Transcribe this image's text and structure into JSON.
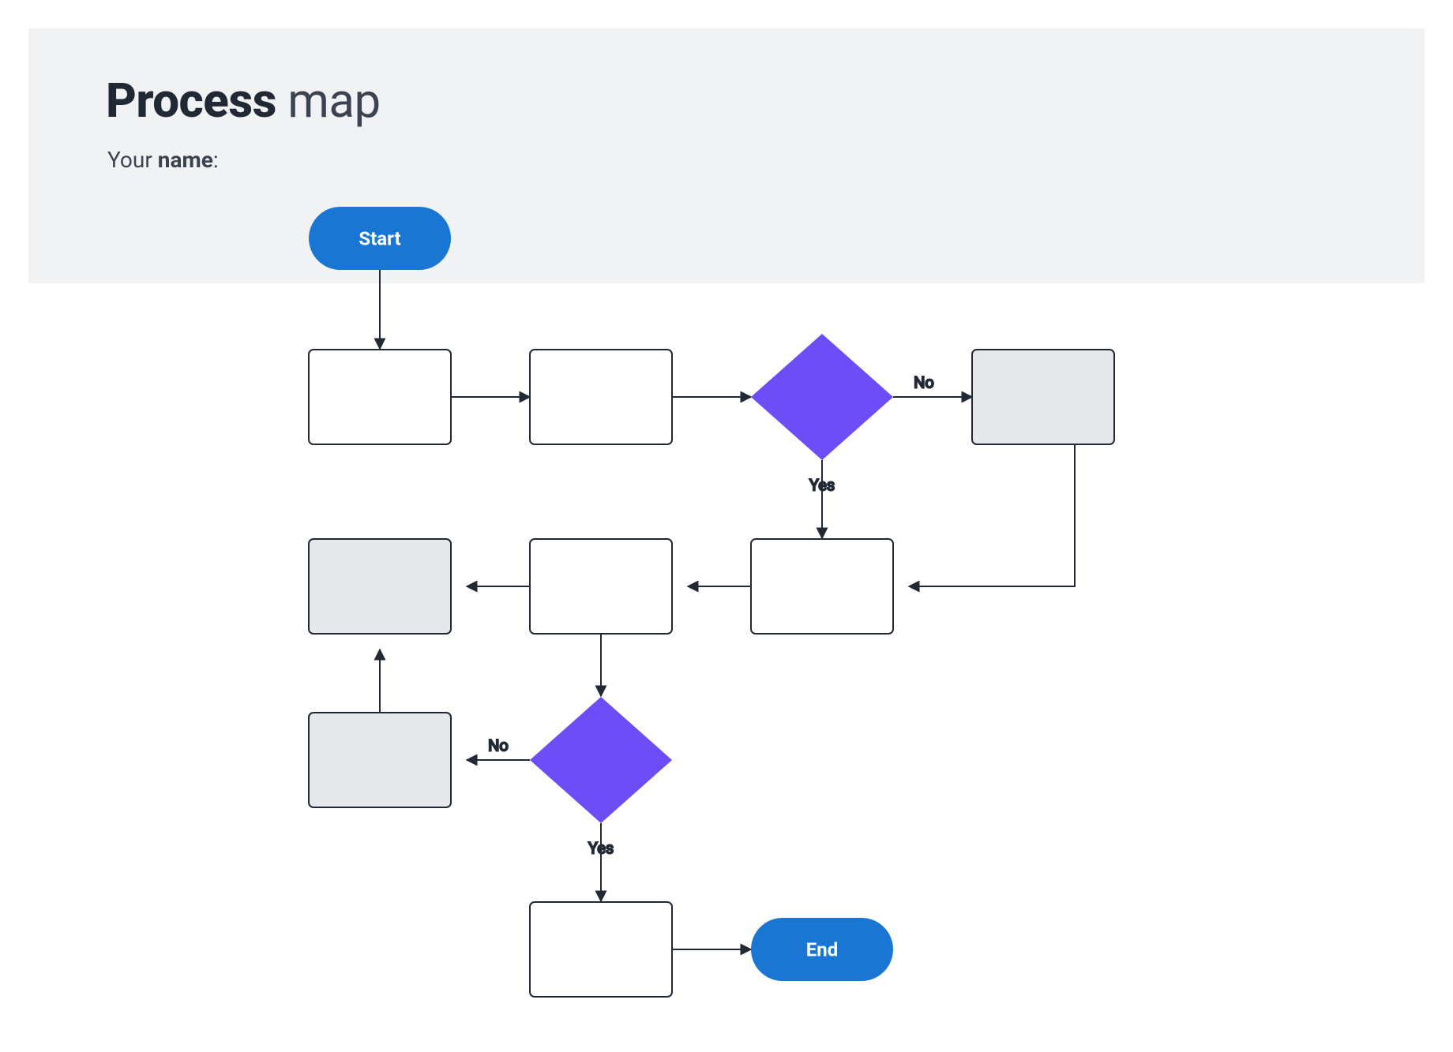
{
  "header": {
    "title_bold": "Process",
    "title_light": " map",
    "subtitle_prefix": "Your ",
    "subtitle_bold": "name",
    "subtitle_suffix": ":"
  },
  "colors": {
    "accent_blue": "#1976D2",
    "diamond_purple": "#6C4DF6",
    "node_stroke": "#212934",
    "gray_fill": "#E6E8EB",
    "white": "#FFFFFF"
  },
  "nodes": {
    "start": {
      "label": "Start",
      "type": "terminator"
    },
    "p1": {
      "label": "",
      "type": "process"
    },
    "p2": {
      "label": "",
      "type": "process"
    },
    "d1": {
      "label": "",
      "type": "decision"
    },
    "g1": {
      "label": "",
      "type": "process_gray"
    },
    "p3": {
      "label": "",
      "type": "process"
    },
    "p4": {
      "label": "",
      "type": "process"
    },
    "g2": {
      "label": "",
      "type": "process_gray"
    },
    "g3": {
      "label": "",
      "type": "process_gray"
    },
    "d2": {
      "label": "",
      "type": "decision"
    },
    "p5": {
      "label": "",
      "type": "process"
    },
    "end": {
      "label": "End",
      "type": "terminator"
    }
  },
  "edges": {
    "d1_no": "No",
    "d1_yes": "Yes",
    "d2_no": "No",
    "d2_yes": "Yes"
  }
}
